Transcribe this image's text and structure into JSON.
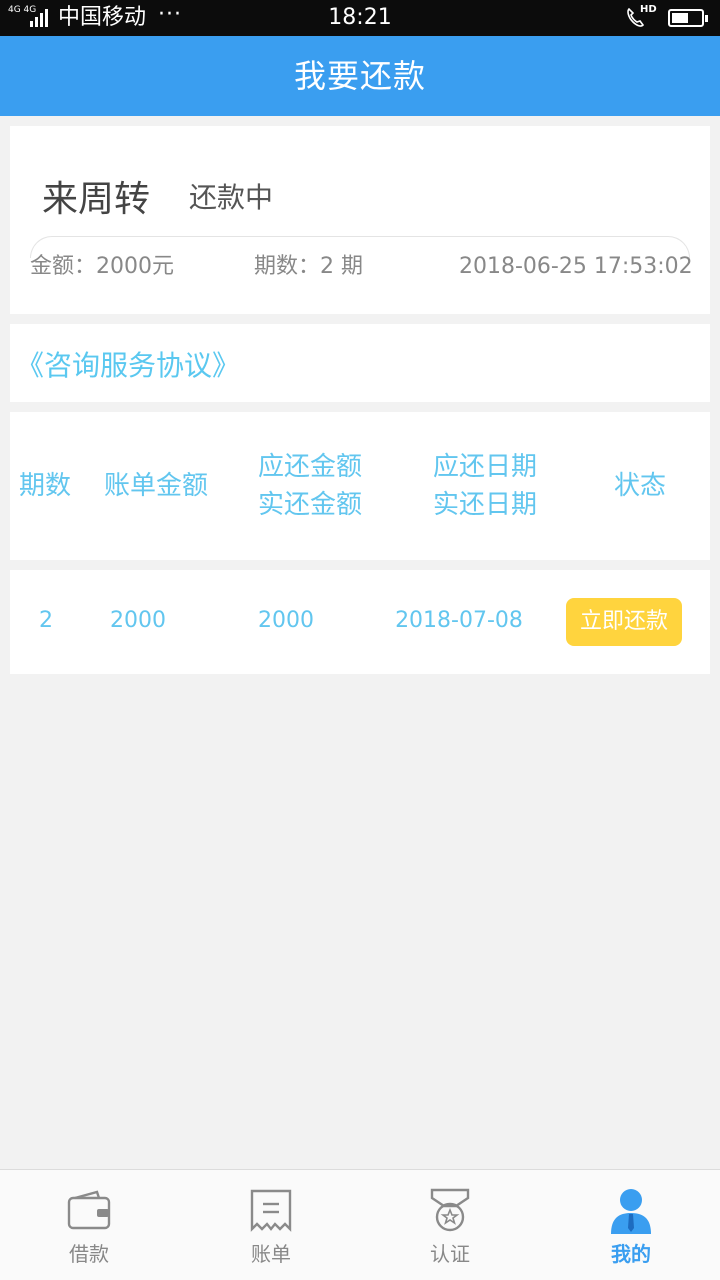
{
  "status_bar": {
    "network": "4G 4G",
    "carrier": "中国移动",
    "dots": "···",
    "time": "18:21",
    "hd": "HD"
  },
  "nav": {
    "title": "我要还款"
  },
  "loan": {
    "name": "来周转",
    "status": "还款中",
    "amount": "金额：2000元",
    "periods": "期数：2 期",
    "datetime": "2018-06-25 17:53:02"
  },
  "agreement": {
    "label": "《咨询服务协议》"
  },
  "table": {
    "headers": {
      "period": "期数",
      "bill_amount": "账单金额",
      "due_amount": "应还金额",
      "paid_amount": "实还金额",
      "due_date": "应还日期",
      "paid_date": "实还日期",
      "status": "状态"
    },
    "rows": [
      {
        "period": "2",
        "bill_amount": "2000",
        "due_amount": "2000",
        "due_date": "2018-07-08",
        "action": "立即还款"
      }
    ]
  },
  "tabs": [
    {
      "label": "借款",
      "icon": "wallet-icon"
    },
    {
      "label": "账单",
      "icon": "bill-icon"
    },
    {
      "label": "认证",
      "icon": "medal-icon"
    },
    {
      "label": "我的",
      "icon": "user-icon"
    }
  ],
  "colors": {
    "primary": "#3a9ef0",
    "table_text": "#62c6ef",
    "button": "#ffd43e",
    "background": "#f2f2f2"
  }
}
